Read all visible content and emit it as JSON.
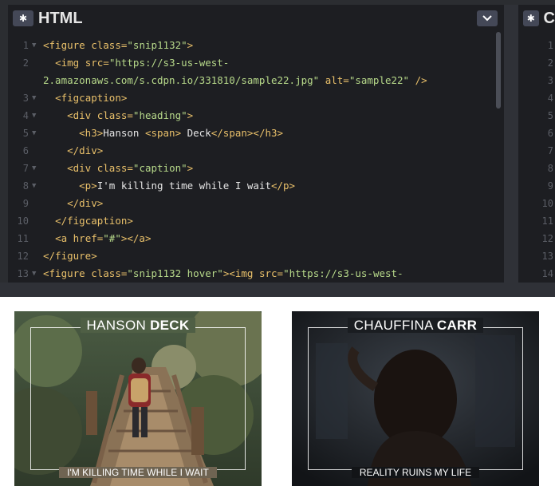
{
  "editor": {
    "html_pane": {
      "title": "HTML",
      "gear_icon": "gear-icon",
      "dropdown_icon": "chevron-down-icon",
      "lines": [
        {
          "n": "1",
          "fold": "▼",
          "parts": [
            [
              "tag",
              "<figure "
            ],
            [
              "attr",
              "class"
            ],
            [
              "tag",
              "="
            ],
            [
              "str",
              "\"snip1132\""
            ],
            [
              "tag",
              ">"
            ]
          ]
        },
        {
          "n": "2",
          "fold": "",
          "parts": [
            [
              "plain",
              "  "
            ],
            [
              "tag",
              "<img "
            ],
            [
              "attr",
              "src"
            ],
            [
              "tag",
              "="
            ],
            [
              "str",
              "\"https://s3-us-west-"
            ]
          ]
        },
        {
          "n": "",
          "fold": "",
          "parts": [
            [
              "str",
              "2.amazonaws.com/s.cdpn.io/331810/sample22.jpg\""
            ],
            [
              "plain",
              " "
            ],
            [
              "attr",
              "alt"
            ],
            [
              "tag",
              "="
            ],
            [
              "str",
              "\"sample22\""
            ],
            [
              "tag",
              " />"
            ]
          ]
        },
        {
          "n": "3",
          "fold": "▼",
          "parts": [
            [
              "plain",
              "  "
            ],
            [
              "tag",
              "<figcaption>"
            ]
          ]
        },
        {
          "n": "4",
          "fold": "▼",
          "parts": [
            [
              "plain",
              "    "
            ],
            [
              "tag",
              "<div "
            ],
            [
              "attr",
              "class"
            ],
            [
              "tag",
              "="
            ],
            [
              "str",
              "\"heading\""
            ],
            [
              "tag",
              ">"
            ]
          ]
        },
        {
          "n": "5",
          "fold": "▼",
          "parts": [
            [
              "plain",
              "      "
            ],
            [
              "tag",
              "<h3>"
            ],
            [
              "plain",
              "Hanson "
            ],
            [
              "tag",
              "<span>"
            ],
            [
              "plain",
              " Deck"
            ],
            [
              "tag",
              "</span></h3>"
            ]
          ]
        },
        {
          "n": "6",
          "fold": "",
          "parts": [
            [
              "plain",
              "    "
            ],
            [
              "tag",
              "</div>"
            ]
          ]
        },
        {
          "n": "7",
          "fold": "▼",
          "parts": [
            [
              "plain",
              "    "
            ],
            [
              "tag",
              "<div "
            ],
            [
              "attr",
              "class"
            ],
            [
              "tag",
              "="
            ],
            [
              "str",
              "\"caption\""
            ],
            [
              "tag",
              ">"
            ]
          ]
        },
        {
          "n": "8",
          "fold": "▼",
          "parts": [
            [
              "plain",
              "      "
            ],
            [
              "tag",
              "<p>"
            ],
            [
              "plain",
              "I'm killing time while I wait"
            ],
            [
              "tag",
              "</p>"
            ]
          ]
        },
        {
          "n": "9",
          "fold": "",
          "parts": [
            [
              "plain",
              "    "
            ],
            [
              "tag",
              "</div>"
            ]
          ]
        },
        {
          "n": "10",
          "fold": "",
          "parts": [
            [
              "plain",
              "  "
            ],
            [
              "tag",
              "</figcaption>"
            ]
          ]
        },
        {
          "n": "11",
          "fold": "",
          "parts": [
            [
              "plain",
              "  "
            ],
            [
              "tag",
              "<a "
            ],
            [
              "attr",
              "href"
            ],
            [
              "tag",
              "="
            ],
            [
              "str",
              "\"#\""
            ],
            [
              "tag",
              "></a>"
            ]
          ]
        },
        {
          "n": "12",
          "fold": "",
          "parts": [
            [
              "tag",
              "</figure>"
            ]
          ]
        },
        {
          "n": "13",
          "fold": "▼",
          "parts": [
            [
              "tag",
              "<figure "
            ],
            [
              "attr",
              "class"
            ],
            [
              "tag",
              "="
            ],
            [
              "str",
              "\"snip1132 hover\""
            ],
            [
              "tag",
              "><img "
            ],
            [
              "attr",
              "src"
            ],
            [
              "tag",
              "="
            ],
            [
              "str",
              "\"https://s3-us-west-"
            ]
          ]
        }
      ]
    },
    "css_pane": {
      "title": "C",
      "gear_icon": "gear-icon",
      "line_numbers": [
        "1",
        "2",
        "3",
        "4",
        "5",
        "6",
        "7",
        "8",
        "9",
        "10",
        "11",
        "12",
        "13",
        "14"
      ]
    }
  },
  "preview": {
    "cards": [
      {
        "heading_light": "HANSON",
        "heading_bold": "DECK",
        "caption": "I'M KILLING TIME WHILE I WAIT"
      },
      {
        "heading_light": "CHAUFFINA",
        "heading_bold": "CARR",
        "caption": "REALITY RUINS MY LIFE"
      }
    ]
  }
}
